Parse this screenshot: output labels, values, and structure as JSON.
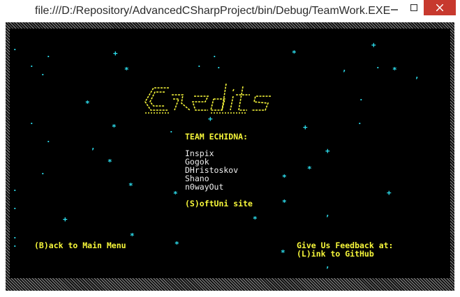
{
  "window": {
    "title": "file:///D:/Repository/AdvancedCSharpProject/bin/Debug/TeamWork.EXE",
    "minimize_icon": "minimize-icon",
    "maximize_icon": "maximize-icon",
    "close_icon": "close-icon"
  },
  "credits": {
    "logo_icon": "credits-ascii-logo",
    "team_heading": "TEAM ECHIDNA:",
    "members": [
      "Inspix",
      "Gogok",
      "DHristoskov",
      "Shano",
      "n0wayOut"
    ],
    "softuni_link": "(S)oftUni site",
    "back_label": "(B)ack to Main Menu",
    "feedback_label": "Give Us Feedback at:",
    "github_link": "(L)ink to GitHub"
  },
  "colors": {
    "console_bg": "#000000",
    "accent_yellow": "#f7f73a",
    "text_white": "#f0f0f0",
    "star_cyan": "#2de0f0",
    "close_red": "#c7392e"
  }
}
